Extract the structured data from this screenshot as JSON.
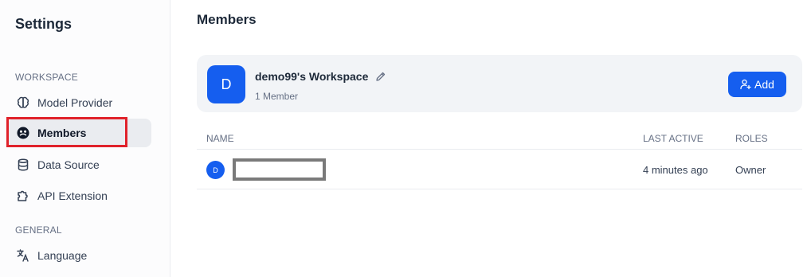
{
  "sidebar": {
    "title": "Settings",
    "groups": [
      {
        "label": "WORKSPACE",
        "items": [
          {
            "label": "Model Provider",
            "icon": "brain-icon"
          },
          {
            "label": "Members",
            "icon": "members-icon",
            "active": true
          },
          {
            "label": "Data Source",
            "icon": "database-icon"
          },
          {
            "label": "API Extension",
            "icon": "puzzle-icon"
          }
        ]
      },
      {
        "label": "GENERAL",
        "items": [
          {
            "label": "Language",
            "icon": "translate-icon"
          }
        ]
      }
    ]
  },
  "main": {
    "title": "Members",
    "workspace": {
      "avatar_letter": "D",
      "name": "demo99's Workspace",
      "member_count": "1 Member",
      "add_label": "Add"
    },
    "table": {
      "headers": [
        "NAME",
        "LAST ACTIVE",
        "ROLES"
      ],
      "rows": [
        {
          "avatar_letter": "D",
          "name": "",
          "last_active": "4 minutes ago",
          "role": "Owner"
        }
      ]
    }
  },
  "colors": {
    "accent": "#155eef",
    "highlight": "#e0222b",
    "sidebar_active_bg": "#eaecf0"
  }
}
